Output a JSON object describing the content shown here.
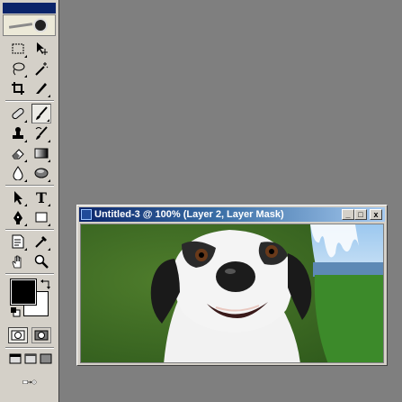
{
  "document": {
    "title": "Untitled-3 @ 100% (Layer 2, Layer Mask)",
    "controls": {
      "minimize": "_",
      "maximize": "□",
      "close": "x"
    }
  },
  "toolbox": {
    "tools": [
      {
        "name": "rectangular-marquee-icon"
      },
      {
        "name": "move-icon"
      },
      {
        "name": "lasso-icon"
      },
      {
        "name": "magic-wand-icon"
      },
      {
        "name": "crop-icon"
      },
      {
        "name": "slice-icon"
      },
      {
        "name": "healing-brush-icon"
      },
      {
        "name": "brush-icon",
        "active": true
      },
      {
        "name": "clone-stamp-icon"
      },
      {
        "name": "history-brush-icon"
      },
      {
        "name": "eraser-icon"
      },
      {
        "name": "gradient-icon"
      },
      {
        "name": "blur-icon"
      },
      {
        "name": "dodge-icon"
      },
      {
        "name": "path-selection-icon"
      },
      {
        "name": "type-icon",
        "label": "T"
      },
      {
        "name": "pen-icon"
      },
      {
        "name": "rectangle-shape-icon"
      },
      {
        "name": "notes-icon"
      },
      {
        "name": "eyedropper-icon"
      },
      {
        "name": "hand-icon"
      },
      {
        "name": "zoom-icon"
      }
    ],
    "foreground_color": "#000000",
    "background_color": "#ffffff"
  },
  "colors": {
    "workspace": "#7f7f7f",
    "chrome": "#d4d0c8",
    "titlebar_start": "#0a246a",
    "titlebar_end": "#a6caf0"
  }
}
